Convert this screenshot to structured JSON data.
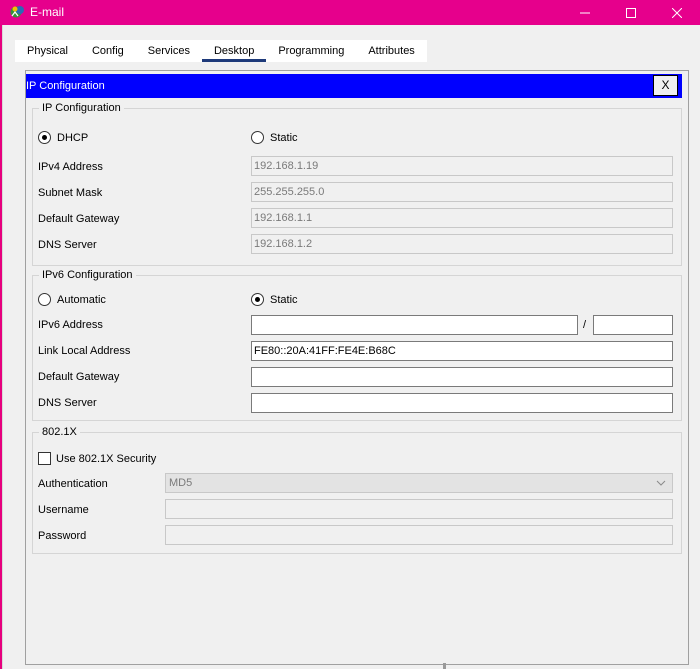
{
  "window": {
    "title": "E-mail",
    "icon": "packet-tracer-device-icon",
    "controls": [
      "minimize-icon",
      "maximize-icon",
      "close-icon"
    ]
  },
  "tabs": [
    {
      "label": "Physical",
      "active": false
    },
    {
      "label": "Config",
      "active": false
    },
    {
      "label": "Services",
      "active": false
    },
    {
      "label": "Desktop",
      "active": true
    },
    {
      "label": "Programming",
      "active": false
    },
    {
      "label": "Attributes",
      "active": false
    }
  ],
  "panel": {
    "title": "IP Configuration",
    "close_label": "X"
  },
  "ipv4": {
    "group_title": "IP Configuration",
    "mode_dhcp_label": "DHCP",
    "mode_static_label": "Static",
    "selected_mode": "DHCP",
    "ipv4_address_label": "IPv4 Address",
    "ipv4_address_value": "192.168.1.19",
    "subnet_mask_label": "Subnet Mask",
    "subnet_mask_value": "255.255.255.0",
    "default_gateway_label": "Default Gateway",
    "default_gateway_value": "192.168.1.1",
    "dns_server_label": "DNS Server",
    "dns_server_value": "192.168.1.2"
  },
  "ipv6": {
    "group_title": "IPv6 Configuration",
    "mode_automatic_label": "Automatic",
    "mode_static_label": "Static",
    "selected_mode": "Static",
    "ipv6_address_label": "IPv6 Address",
    "ipv6_address_value": "",
    "prefix_separator": "/",
    "prefix_value": "",
    "link_local_label": "Link Local Address",
    "link_local_value": "FE80::20A:41FF:FE4E:B68C",
    "default_gateway_label": "Default Gateway",
    "default_gateway_value": "",
    "dns_server_label": "DNS Server",
    "dns_server_value": ""
  },
  "dot1x": {
    "group_title": "802.1X",
    "use_security_label": "Use 802.1X Security",
    "use_security_checked": false,
    "authentication_label": "Authentication",
    "authentication_value": "MD5",
    "username_label": "Username",
    "username_value": "",
    "password_label": "Password",
    "password_value": ""
  },
  "colors": {
    "titlebar": "#e6008c",
    "panel_header": "#0000ff",
    "active_tab_underline": "#1e3a7a"
  }
}
